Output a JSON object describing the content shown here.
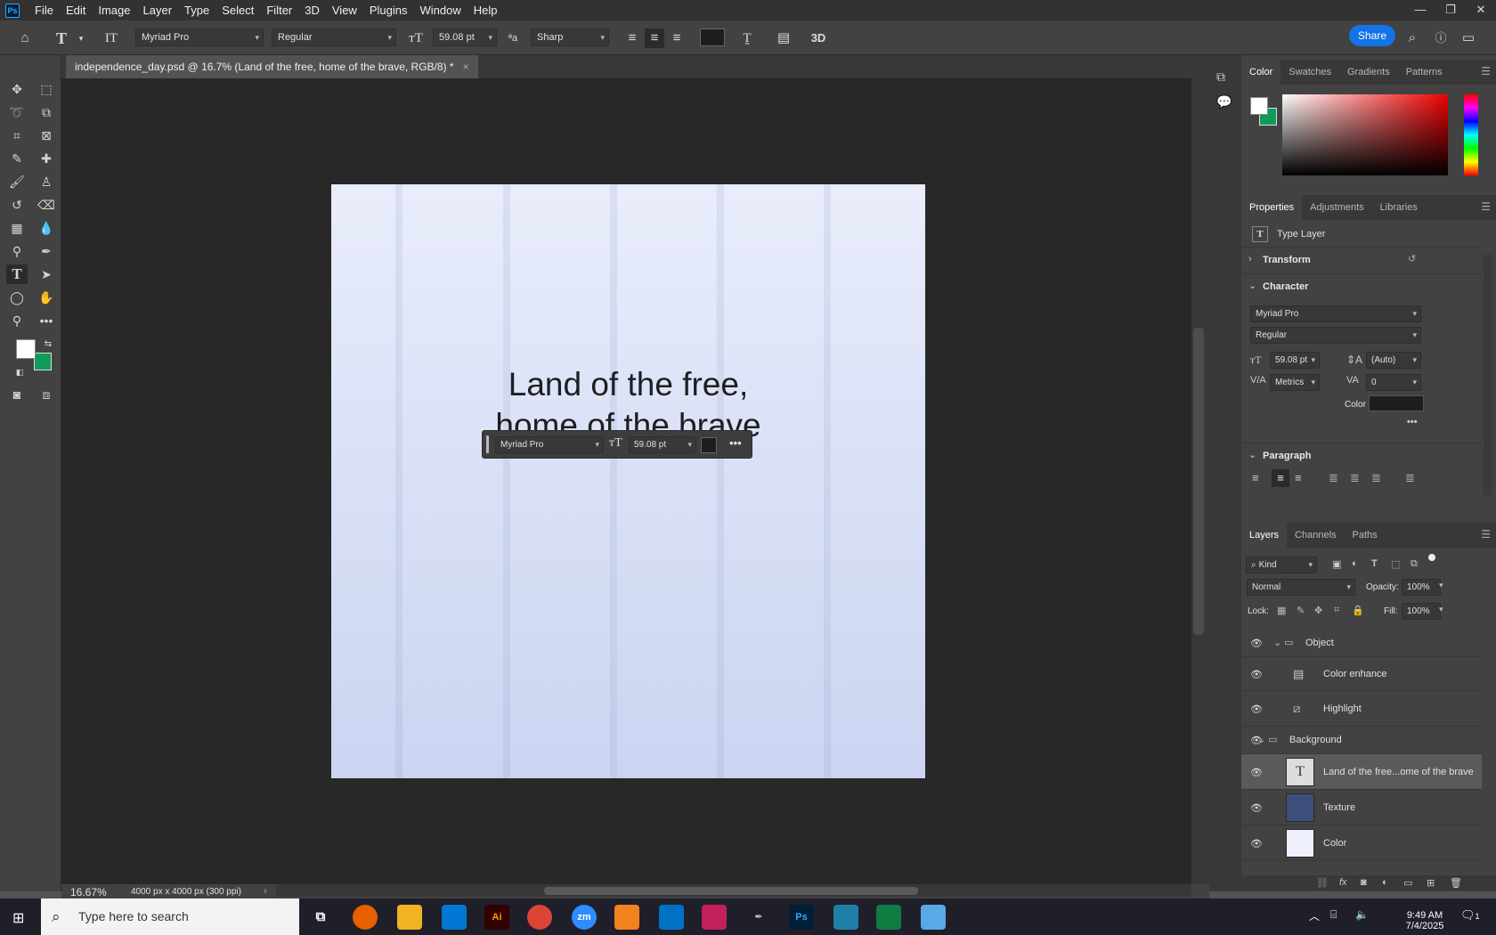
{
  "menubar": {
    "app_logo": "Ps",
    "items": [
      "File",
      "Edit",
      "Image",
      "Layer",
      "Type",
      "Select",
      "Filter",
      "3D",
      "View",
      "Plugins",
      "Window",
      "Help"
    ]
  },
  "options": {
    "font_family": "Myriad Pro",
    "font_style": "Regular",
    "font_size": "59.08 pt",
    "anti_alias": "Sharp",
    "share_label": "Share",
    "three_d_label": "3D",
    "color": "#1e1e1e"
  },
  "document": {
    "tab_title": "independence_day.psd @ 16.7% (Land of the free,  home of the brave, RGB/8) *",
    "canvas_text_line1": "Land of the free,",
    "canvas_text_line2": "home of the brave",
    "zoom": "16.67%",
    "doc_size": "4000 px x 4000 px (300 ppi)"
  },
  "floating_toolbar": {
    "font": "Myriad Pro",
    "size": "59.08 pt"
  },
  "color_panel": {
    "tabs": [
      "Color",
      "Swatches",
      "Gradients",
      "Patterns"
    ],
    "fg": "#ffffff",
    "bg": "#0f9b5a"
  },
  "properties": {
    "tabs": [
      "Properties",
      "Adjustments",
      "Libraries"
    ],
    "layer_type": "Type Layer",
    "transform": "Transform",
    "character": "Character",
    "font_family": "Myriad Pro",
    "font_style": "Regular",
    "size": "59.08 pt",
    "leading": "(Auto)",
    "kerning": "Metrics",
    "tracking": "0",
    "color_label": "Color",
    "paragraph": "Paragraph"
  },
  "layers": {
    "tabs": [
      "Layers",
      "Channels",
      "Paths"
    ],
    "filter": "Kind",
    "blend": "Normal",
    "opacity_label": "Opacity:",
    "opacity": "100%",
    "lock_label": "Lock:",
    "fill_label": "Fill:",
    "fill": "100%",
    "rows": [
      {
        "name": "Object",
        "kind": "group"
      },
      {
        "name": "Color enhance",
        "kind": "adjust"
      },
      {
        "name": "Highlight",
        "kind": "adjust"
      },
      {
        "name": "Background",
        "kind": "group"
      },
      {
        "name": "Land of the free...ome of the brave",
        "kind": "text"
      },
      {
        "name": "Texture",
        "kind": "texture"
      },
      {
        "name": "Color",
        "kind": "fill"
      }
    ]
  },
  "taskbar": {
    "search_placeholder": "Type here to search",
    "time": "9:49 AM",
    "date": "7/4/2025",
    "notif_count": "1"
  }
}
